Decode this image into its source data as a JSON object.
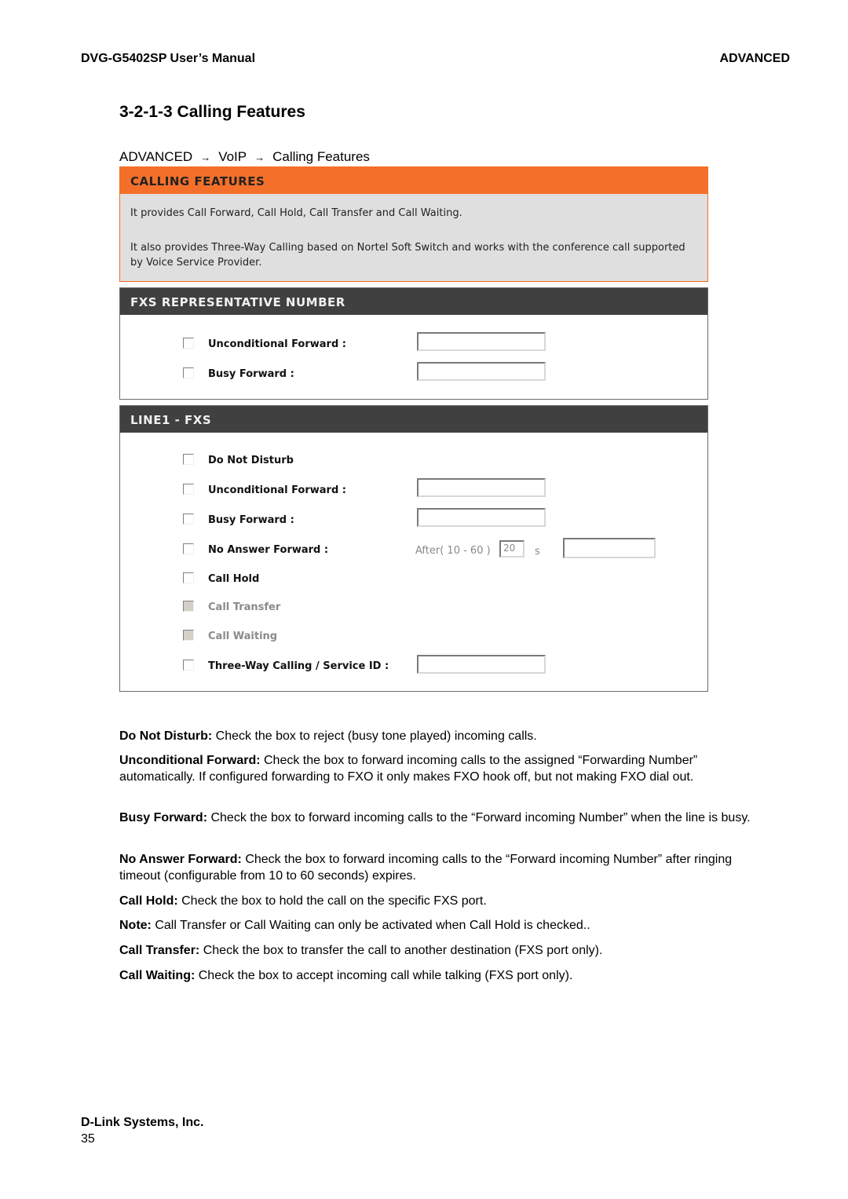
{
  "header": {
    "manual_title": "DVG-G5402SP User’s Manual",
    "section": "ADVANCED"
  },
  "section_title": "3-2-1-3 Calling Features",
  "breadcrumb": {
    "items": [
      "ADVANCED",
      "VoIP",
      "Calling Features"
    ],
    "separator": "→"
  },
  "calling_features_panel": {
    "title": "CALLING FEATURES",
    "line1": "It provides Call Forward, Call Hold, Call Transfer and Call Waiting.",
    "line2": "It also provides Three-Way Calling based on Nortel Soft Switch and works with the conference call supported by Voice Service Provider.",
    "color": "#f4702a"
  },
  "fxs_panel": {
    "title": "FXS REPRESENTATIVE NUMBER",
    "rows": [
      {
        "label": "Unconditional Forward :",
        "checked": false,
        "value": ""
      },
      {
        "label": "Busy Forward :",
        "checked": false,
        "value": ""
      }
    ]
  },
  "line1_panel": {
    "title": "LINE1 - FXS",
    "rows": [
      {
        "label": "Do Not Disturb",
        "checked": false,
        "disabled": false
      },
      {
        "label": "Unconditional Forward :",
        "checked": false,
        "disabled": false,
        "value": ""
      },
      {
        "label": "Busy Forward :",
        "checked": false,
        "disabled": false,
        "value": ""
      },
      {
        "label": "No Answer Forward :",
        "checked": false,
        "disabled": false,
        "value": ""
      },
      {
        "label": "Call Hold",
        "checked": false,
        "disabled": false
      },
      {
        "label": "Call Transfer",
        "checked": false,
        "disabled": true
      },
      {
        "label": "Call Waiting",
        "checked": false,
        "disabled": true
      },
      {
        "label": "Three-Way Calling / Service ID :",
        "checked": false,
        "disabled": false,
        "value": ""
      }
    ],
    "no_answer": {
      "after_label": "After( 10 - 60 )",
      "timeout_value": "20",
      "unit": "s"
    }
  },
  "descriptions": [
    {
      "term": "Do Not Disturb:",
      "text": " Check the box to reject (busy tone played) incoming calls."
    },
    {
      "term": "Unconditional Forward:",
      "text": " Check the box to forward incoming calls to the assigned “Forwarding Number” automatically. If configured forwarding to FXO it only makes FXO hook off, but not making FXO dial out."
    },
    {
      "term": "Busy Forward:",
      "text": " Check the box to forward incoming calls to the “Forward incoming Number” when the line is busy."
    },
    {
      "term": "No Answer Forward:",
      "text": " Check the box to forward incoming calls to the “Forward incoming Number” after ringing timeout (configurable from 10 to 60 seconds) expires."
    },
    {
      "term": "Call Hold:",
      "text": " Check the box to hold the call on the specific FXS port."
    },
    {
      "term": "Note:",
      "text": " Call Transfer or Call Waiting can only be activated when Call Hold is checked.."
    },
    {
      "term": "Call Transfer:",
      "text": " Check the box to transfer the call to another destination (FXS port only)."
    },
    {
      "term": "Call Waiting:",
      "text": " Check the box to accept incoming call while talking (FXS port only)."
    }
  ],
  "footer": {
    "company": "D-Link Systems, Inc.",
    "page": "35"
  }
}
